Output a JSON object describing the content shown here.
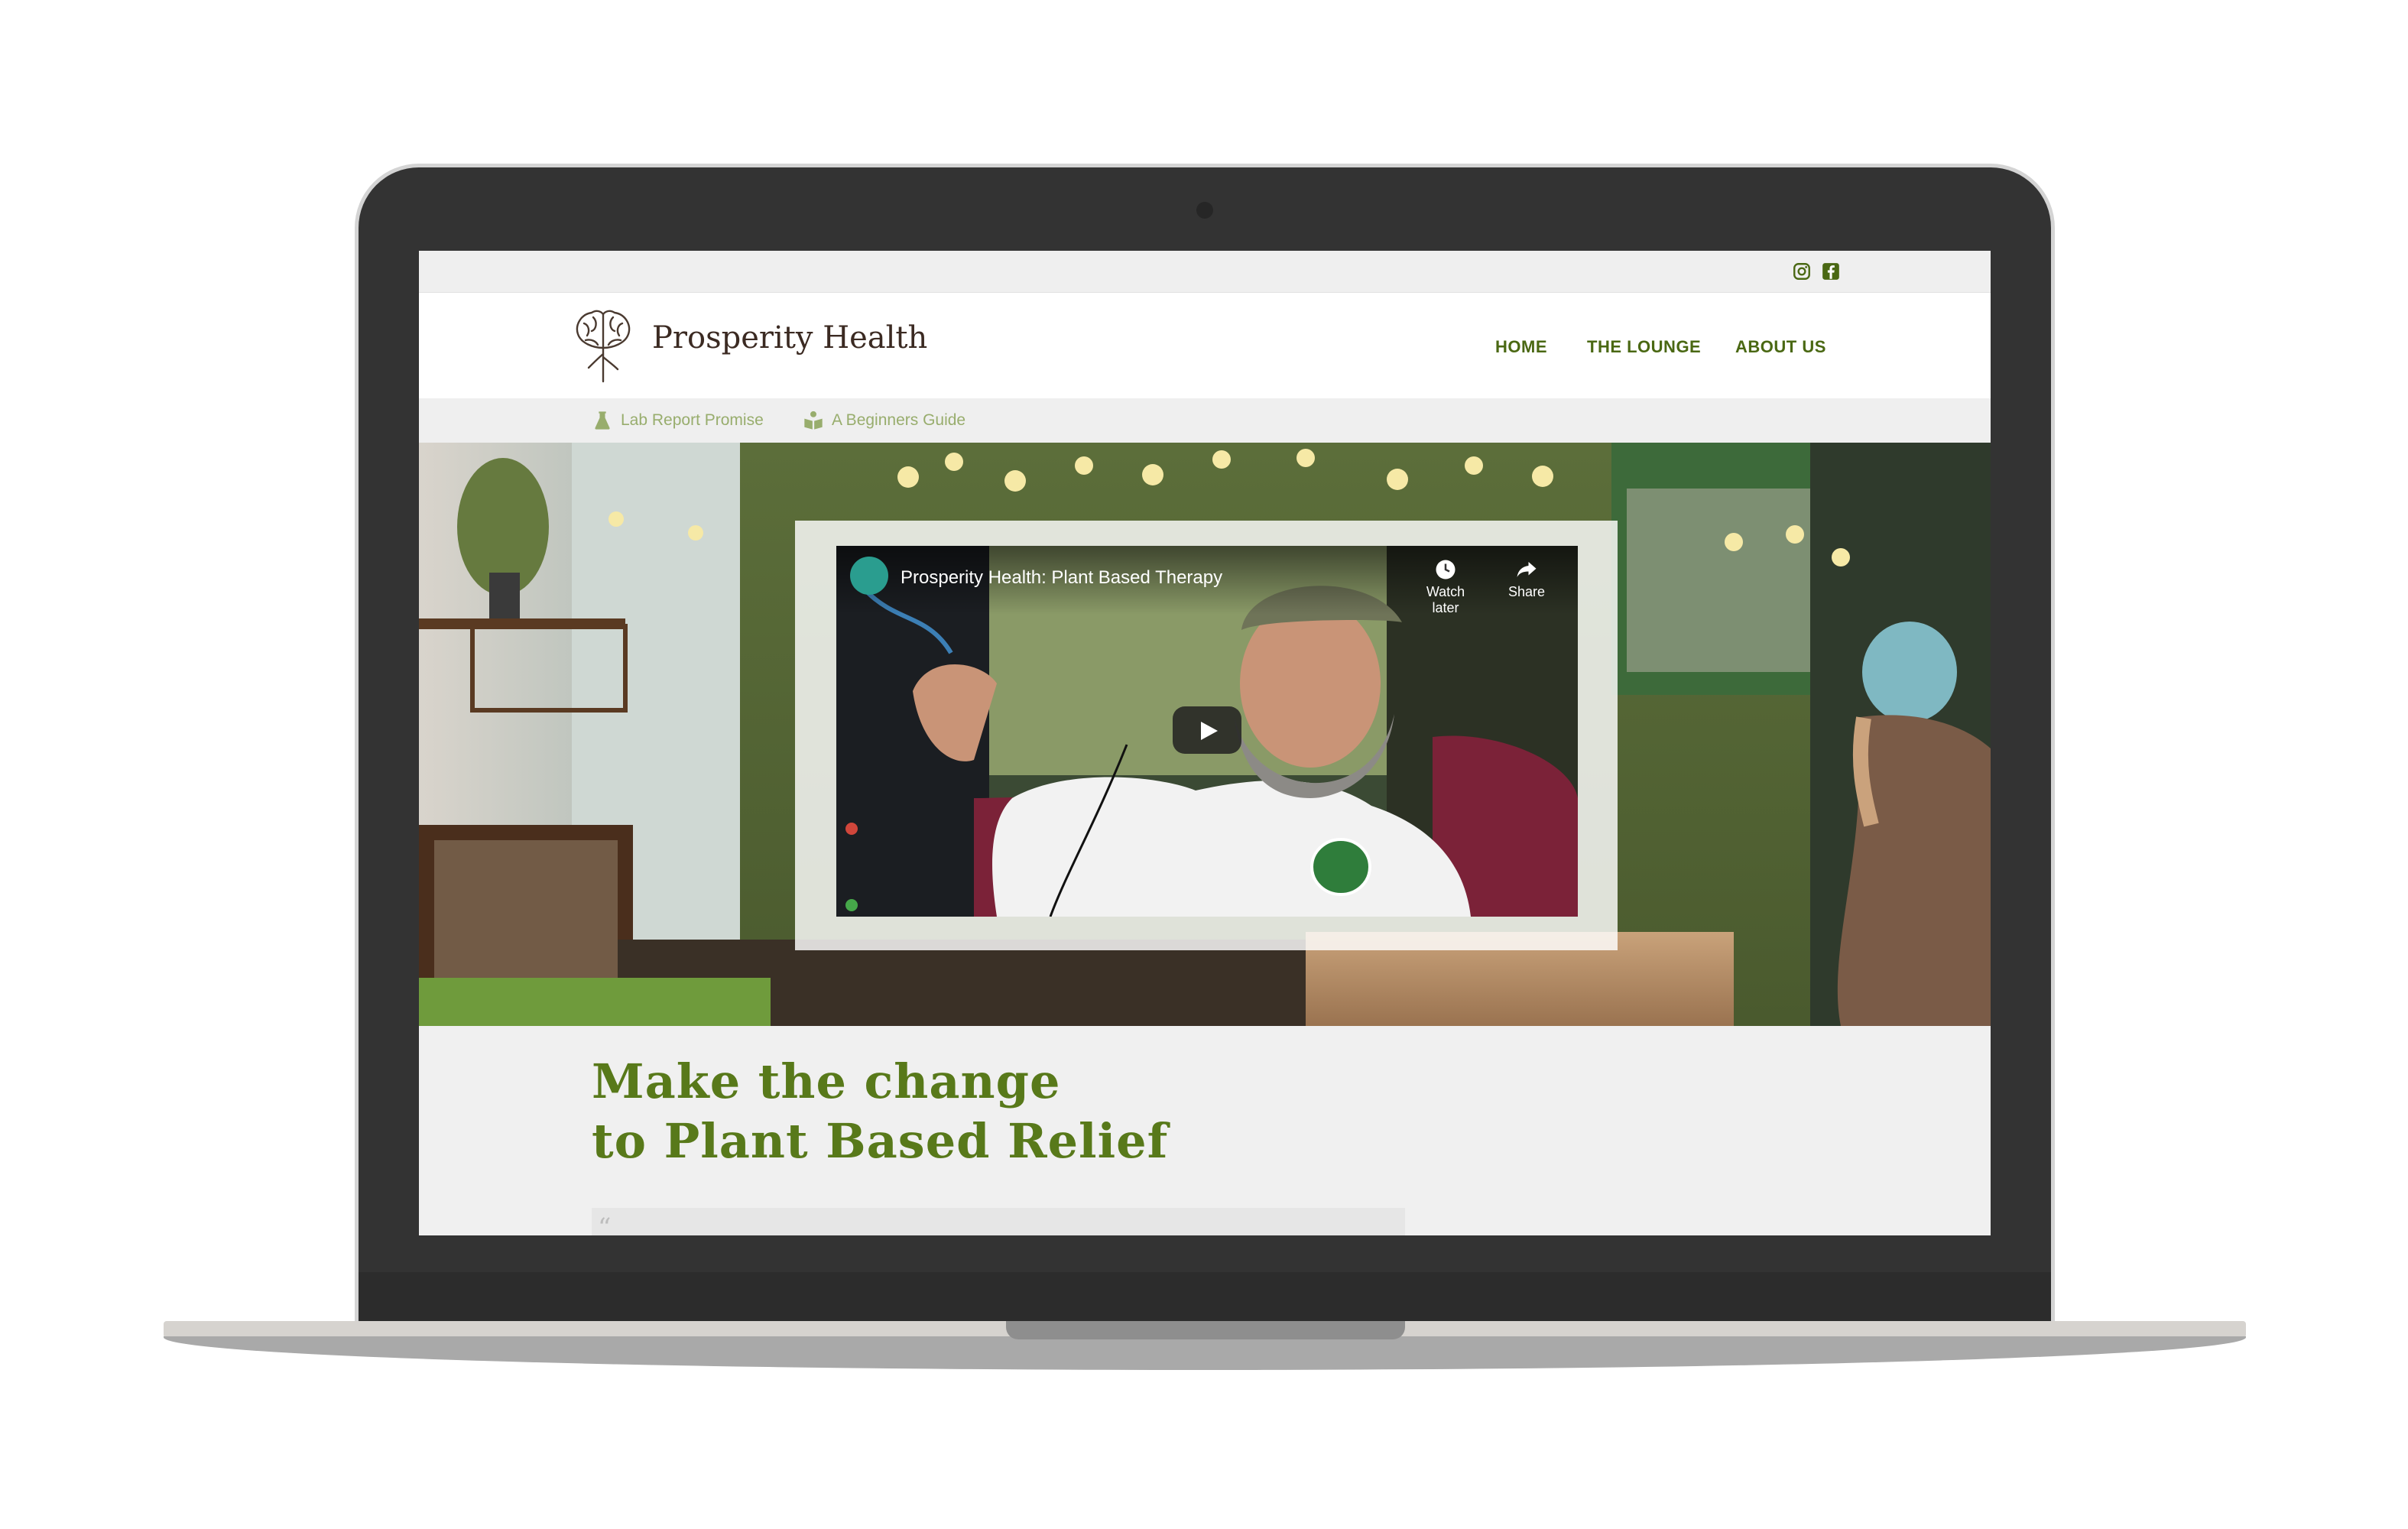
{
  "site": {
    "brand": "Prosperity Health",
    "nav": [
      {
        "label": "HOME"
      },
      {
        "label": "THE LOUNGE"
      },
      {
        "label": "ABOUT US"
      }
    ],
    "subnav": [
      {
        "label": "Lab Report Promise",
        "icon": "flask-icon"
      },
      {
        "label": "A Beginners Guide",
        "icon": "book-reader-icon"
      }
    ],
    "social": [
      {
        "icon": "instagram-icon"
      },
      {
        "icon": "facebook-icon"
      }
    ],
    "colors": {
      "accent_green": "#58791a",
      "nav_green": "#4a6813",
      "subnav_green": "#98ad6d",
      "brand_brown": "#3b2a22"
    }
  },
  "video": {
    "title": "Prosperity Health: Plant Based Therapy",
    "watch_later": "Watch later",
    "share": "Share"
  },
  "hero": {
    "headline_line1": "Make the change",
    "headline_line2": "to Plant Based Relief"
  },
  "quote": {
    "mark": "“"
  }
}
